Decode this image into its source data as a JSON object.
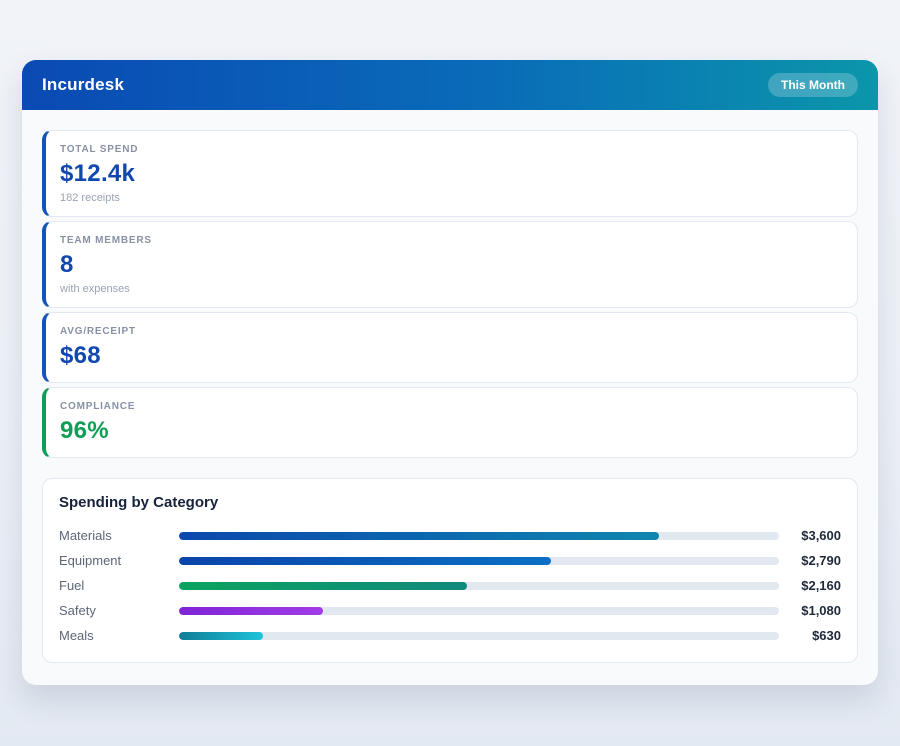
{
  "header": {
    "title": "Incurdesk",
    "badge": "This Month",
    "gradient_start": "#0a4ab4",
    "gradient_end": "#0b96aa"
  },
  "stats": [
    {
      "label": "TOTAL SPEND",
      "value": "$12.4k",
      "sub": "182 receipts",
      "accent": "#1553b8"
    },
    {
      "label": "TEAM MEMBERS",
      "value": "8",
      "sub": "with expenses",
      "accent": "#1553b8"
    },
    {
      "label": "AVG/RECEIPT",
      "value": "$68",
      "sub": "",
      "accent": "#1553b8"
    },
    {
      "label": "COMPLIANCE",
      "value": "96%",
      "sub": "",
      "accent": "#0f9e56"
    }
  ],
  "chart": {
    "title": "Spending by Category",
    "track_color": "#e2e8f0",
    "rows": [
      {
        "label": "Materials",
        "value_label": "$3,600",
        "percent": 80,
        "color_start": "#0b47ad",
        "color_end": "#0e86ae"
      },
      {
        "label": "Equipment",
        "value_label": "$2,790",
        "percent": 62,
        "color_start": "#0b44aa",
        "color_end": "#0a6fc4"
      },
      {
        "label": "Fuel",
        "value_label": "$2,160",
        "percent": 48,
        "color_start": "#0ba35f",
        "color_end": "#11897d"
      },
      {
        "label": "Safety",
        "value_label": "$1,080",
        "percent": 24,
        "color_start": "#7e24d6",
        "color_end": "#a13ce8"
      },
      {
        "label": "Meals",
        "value_label": "$630",
        "percent": 14,
        "color_start": "#0f7d95",
        "color_end": "#1ec3da"
      }
    ]
  },
  "chart_data": {
    "type": "bar",
    "orientation": "horizontal",
    "title": "Spending by Category",
    "categories": [
      "Materials",
      "Equipment",
      "Fuel",
      "Safety",
      "Meals"
    ],
    "values": [
      3600,
      2790,
      2160,
      1080,
      630
    ],
    "value_labels": [
      "$3,600",
      "$2,790",
      "$2,160",
      "$1,080",
      "$630"
    ],
    "xlim": [
      0,
      4500
    ],
    "grid": false,
    "legend": false
  }
}
